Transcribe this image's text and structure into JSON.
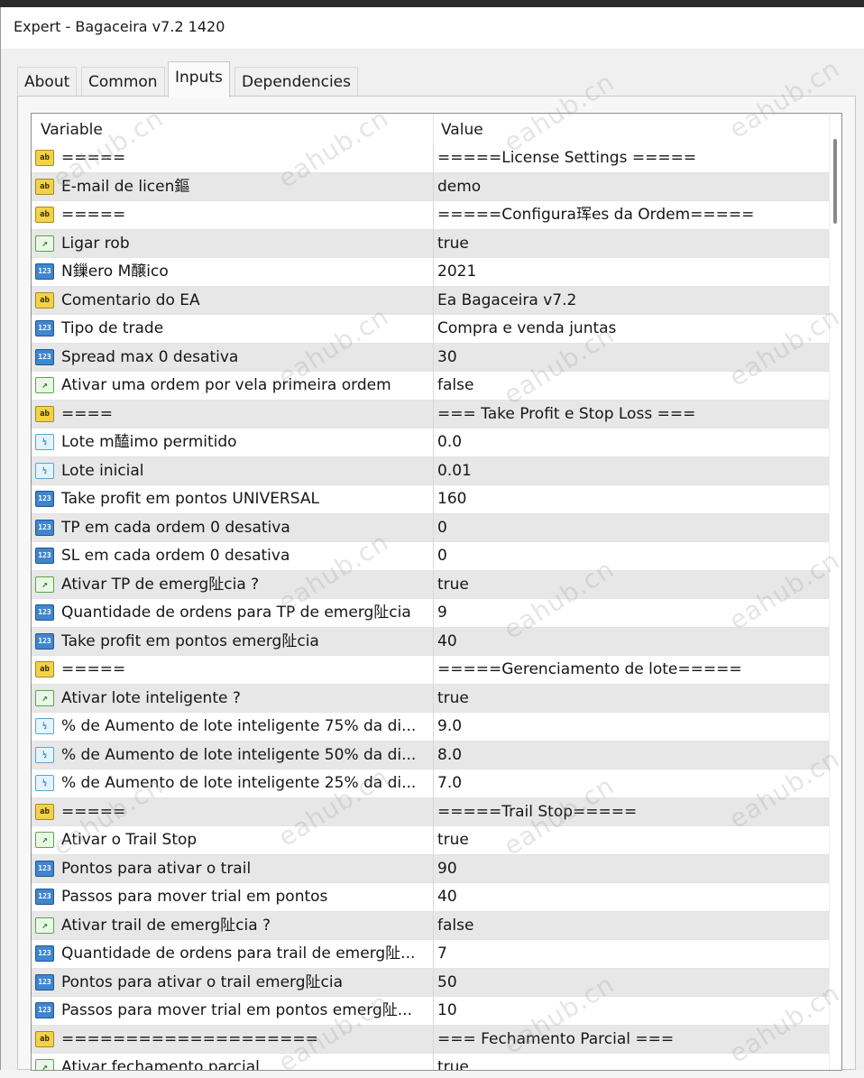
{
  "window": {
    "title": "Expert - Bagaceira v7.2 1420"
  },
  "tabs": [
    {
      "label": "About"
    },
    {
      "label": "Common"
    },
    {
      "label": "Inputs",
      "active": true
    },
    {
      "label": "Dependencies"
    }
  ],
  "grid": {
    "columns": {
      "variable": "Variable",
      "value": "Value"
    },
    "rows": [
      {
        "icon": "ab",
        "variable": "=====",
        "value": "=====License Settings ====="
      },
      {
        "icon": "ab",
        "variable": "E-mail de licen鏂",
        "value": "demo"
      },
      {
        "icon": "ab",
        "variable": "=====",
        "value": "=====Configura珲es da Ordem====="
      },
      {
        "icon": "bool",
        "variable": "Ligar rob",
        "value": "true"
      },
      {
        "icon": "123",
        "variable": "N鏁ero M醸ico",
        "value": "2021"
      },
      {
        "icon": "ab",
        "variable": "Comentario do EA",
        "value": "Ea Bagaceira v7.2"
      },
      {
        "icon": "123",
        "variable": "Tipo de trade",
        "value": "Compra e venda juntas"
      },
      {
        "icon": "123",
        "variable": "Spread max 0 desativa",
        "value": "30"
      },
      {
        "icon": "bool",
        "variable": "Ativar uma ordem por vela primeira ordem",
        "value": "false"
      },
      {
        "icon": "ab",
        "variable": "====",
        "value": "=== Take Profit e Stop Loss ==="
      },
      {
        "icon": "frac",
        "variable": "Lote m醘imo permitido",
        "value": "0.0"
      },
      {
        "icon": "frac",
        "variable": "Lote inicial",
        "value": "0.01"
      },
      {
        "icon": "123",
        "variable": "Take profit em pontos UNIVERSAL",
        "value": "160"
      },
      {
        "icon": "123",
        "variable": "TP em cada ordem 0 desativa",
        "value": "0"
      },
      {
        "icon": "123",
        "variable": "SL em cada ordem 0 desativa",
        "value": "0"
      },
      {
        "icon": "bool",
        "variable": "Ativar TP de emerg阯cia ?",
        "value": "true"
      },
      {
        "icon": "123",
        "variable": "Quantidade de ordens para TP de emerg阯cia",
        "value": "9"
      },
      {
        "icon": "123",
        "variable": "Take profit em pontos emerg阯cia",
        "value": "40"
      },
      {
        "icon": "ab",
        "variable": "=====",
        "value": "=====Gerenciamento de lote====="
      },
      {
        "icon": "bool",
        "variable": "Ativar lote inteligente ?",
        "value": "true"
      },
      {
        "icon": "frac",
        "variable": "% de Aumento de lote inteligente 75% da di...",
        "value": "9.0"
      },
      {
        "icon": "frac",
        "variable": "% de Aumento de lote inteligente 50% da di...",
        "value": "8.0"
      },
      {
        "icon": "frac",
        "variable": "% de Aumento de lote inteligente 25% da di...",
        "value": "7.0"
      },
      {
        "icon": "ab",
        "variable": "=====",
        "value": "=====Trail Stop====="
      },
      {
        "icon": "bool",
        "variable": "Ativar o Trail Stop",
        "value": "true"
      },
      {
        "icon": "123",
        "variable": "Pontos para ativar o trail",
        "value": "90"
      },
      {
        "icon": "123",
        "variable": "Passos para mover trial em pontos",
        "value": "40"
      },
      {
        "icon": "bool",
        "variable": "Ativar trail de emerg阯cia ?",
        "value": "false"
      },
      {
        "icon": "123",
        "variable": "Quantidade de ordens para trail de emerg阯...",
        "value": "7"
      },
      {
        "icon": "123",
        "variable": "Pontos para ativar o trail emerg阯cia",
        "value": "50"
      },
      {
        "icon": "123",
        "variable": "Passos para mover trial em pontos emerg阯...",
        "value": "10"
      },
      {
        "icon": "ab",
        "variable": "====================",
        "value": "=== Fechamento Parcial ==="
      },
      {
        "icon": "bool",
        "variable": "Ativar fechamento parcial",
        "value": "true"
      }
    ]
  },
  "icon_names": {
    "ab": "string-type-icon",
    "123": "integer-type-icon",
    "frac": "double-type-icon",
    "bool": "bool-type-icon"
  },
  "watermark": "eahub.cn"
}
